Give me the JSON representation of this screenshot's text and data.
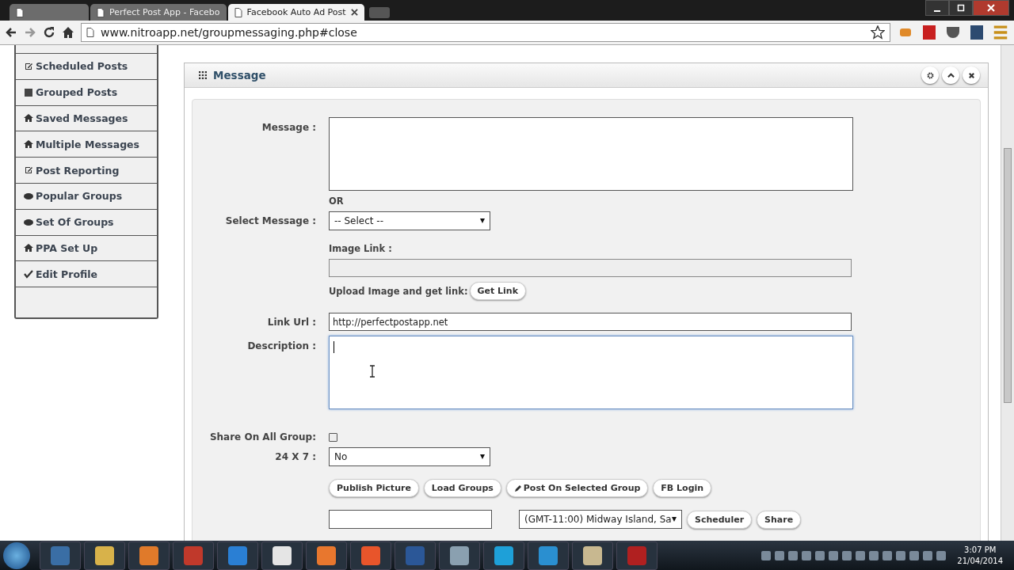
{
  "browser": {
    "tabs": [
      {
        "selected": false
      },
      {
        "label": "Perfect Post App - Facebo",
        "selected": false
      },
      {
        "label": "Facebook Auto Ad Post",
        "selected": true
      }
    ],
    "url": "www.nitroapp.net/groupmessaging.php#close"
  },
  "sidebar": {
    "items": [
      {
        "label": "Scheduled Posts",
        "kind": "edit"
      },
      {
        "label": "Grouped Posts",
        "kind": "list"
      },
      {
        "label": "Saved Messages",
        "kind": "home"
      },
      {
        "label": "Multiple Messages",
        "kind": "home"
      },
      {
        "label": "Post Reporting",
        "kind": "edit"
      },
      {
        "label": "Popular Groups",
        "kind": "eye"
      },
      {
        "label": "Set Of Groups",
        "kind": "eye"
      },
      {
        "label": "PPA Set Up",
        "kind": "home"
      },
      {
        "label": "Edit Profile",
        "kind": "check"
      }
    ]
  },
  "panel": {
    "title": "Message",
    "message_label": "Message :",
    "or": "OR",
    "select_label": "Select Message :",
    "select_value": "-- Select --",
    "image_label": "Image Link :",
    "upload_text": "Upload Image and get link:",
    "get_link": "Get Link",
    "link_label": "Link Url :",
    "link_value": "http://perfectpostapp.net",
    "description_label": "Description :",
    "share_label": "Share On All Group:",
    "share_checked": false,
    "schedule_label": "24 X 7 :",
    "schedule_value": "No",
    "buttons": [
      "Publish Picture",
      "Load Groups",
      "Post On Selected Group",
      "FB Login"
    ],
    "timezone": "(GMT-11:00) Midway Island, Sa",
    "bottom_buttons": [
      "Scheduler",
      "Share"
    ]
  },
  "taskbar": {
    "time": "3:07 PM",
    "date": "21/04/2014"
  }
}
